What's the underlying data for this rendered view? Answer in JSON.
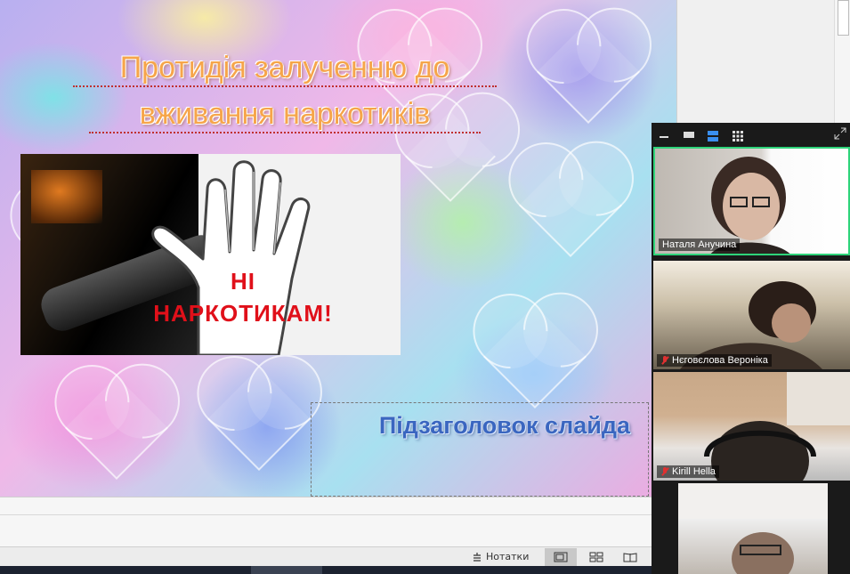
{
  "slide": {
    "title_line1": "Протидія залученню до",
    "title_line2": "вживання наркотиків",
    "poster_line1": "НІ",
    "poster_line2": "НАРКОТИКАМ!",
    "subtitle": "Підзаголовок слайда"
  },
  "status_bar": {
    "notes_label": "Нотатки",
    "views": [
      "normal-view",
      "slide-sorter-view",
      "reading-view"
    ]
  },
  "zoom": {
    "toolbar_icons": [
      "minimize-icon",
      "thumbnail-icon",
      "speaker-view-icon",
      "gallery-view-icon",
      "fullscreen-icon"
    ],
    "participants": [
      {
        "name": "Наталя Анучина",
        "muted": false,
        "active_speaker": true
      },
      {
        "name": "Нєговєлова Вероніка",
        "muted": true,
        "active_speaker": false
      },
      {
        "name": "Kirill Hella",
        "muted": true,
        "active_speaker": false
      },
      {
        "name": "",
        "muted": false,
        "active_speaker": false
      }
    ]
  },
  "colors": {
    "title": "#f6a54a",
    "poster_text": "#e0101a",
    "subtitle": "#3a66c0",
    "active_speaker_border": "#2ed47a",
    "muted_mic": "#e03030"
  }
}
